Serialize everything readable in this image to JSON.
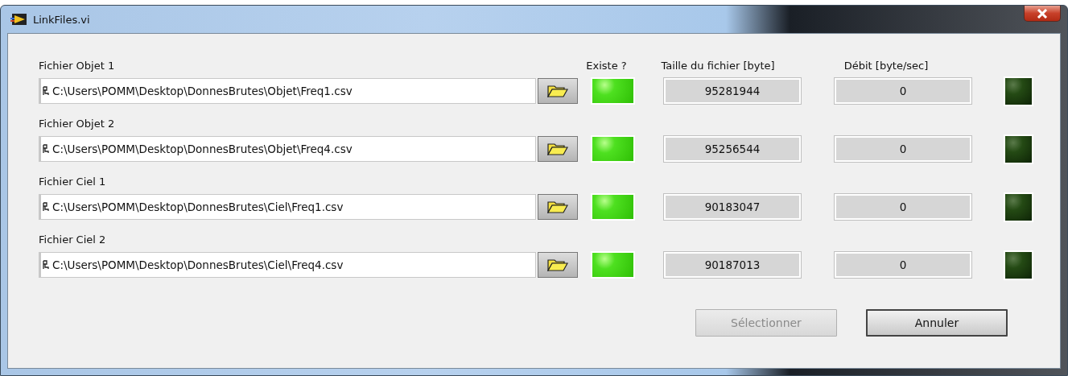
{
  "window": {
    "title": "LinkFiles.vi"
  },
  "columns": {
    "exists": "Existe ?",
    "size": "Taille du fichier [byte]",
    "rate": "Débit [byte/sec]"
  },
  "files": [
    {
      "label": "Fichier Objet 1",
      "path": "C:\\Users\\POMM\\Desktop\\DonnesBrutes\\Objet\\Freq1.csv",
      "exists": true,
      "size": "95281944",
      "rate": "0",
      "active": false
    },
    {
      "label": "Fichier Objet 2",
      "path": "C:\\Users\\POMM\\Desktop\\DonnesBrutes\\Objet\\Freq4.csv",
      "exists": true,
      "size": "95256544",
      "rate": "0",
      "active": false
    },
    {
      "label": "Fichier Ciel 1",
      "path": "C:\\Users\\POMM\\Desktop\\DonnesBrutes\\Ciel\\Freq1.csv",
      "exists": true,
      "size": "90183047",
      "rate": "0",
      "active": false
    },
    {
      "label": "Fichier Ciel 2",
      "path": "C:\\Users\\POMM\\Desktop\\DonnesBrutes\\Ciel\\Freq4.csv",
      "exists": true,
      "size": "90187013",
      "rate": "0",
      "active": false
    }
  ],
  "buttons": [
    {
      "label": "Sélectionner",
      "disabled": true
    },
    {
      "label": "Annuler",
      "disabled": false
    }
  ]
}
